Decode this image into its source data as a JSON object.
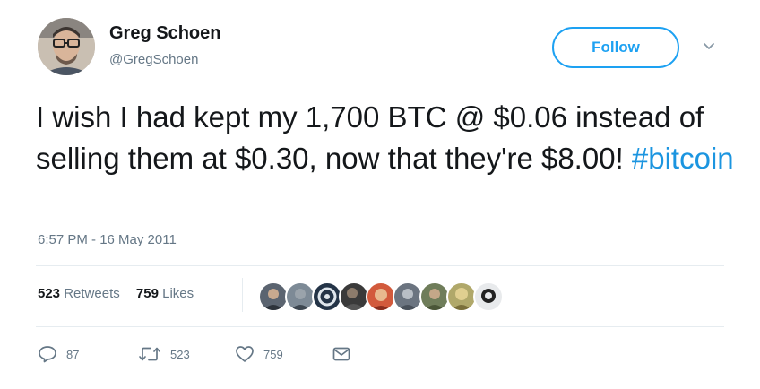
{
  "user": {
    "name": "Greg Schoen",
    "handle": "@GregSchoen"
  },
  "follow_label": "Follow",
  "tweet": {
    "text_before": "I wish I had kept my 1,700 BTC @ $0.06 instead of selling them at $0.30, now that they're $8.00! ",
    "hashtag": "#bitcoin",
    "timestamp": "6:57 PM - 16 May 2011"
  },
  "stats": {
    "retweets_count": "523",
    "retweets_label": "Retweets",
    "likes_count": "759",
    "likes_label": "Likes"
  },
  "actions": {
    "reply_count": "87",
    "retweet_count": "523",
    "like_count": "759"
  },
  "colors": {
    "accent": "#1da1f2",
    "hashtag": "#1b95e0",
    "muted": "#657786",
    "text": "#14171a"
  }
}
